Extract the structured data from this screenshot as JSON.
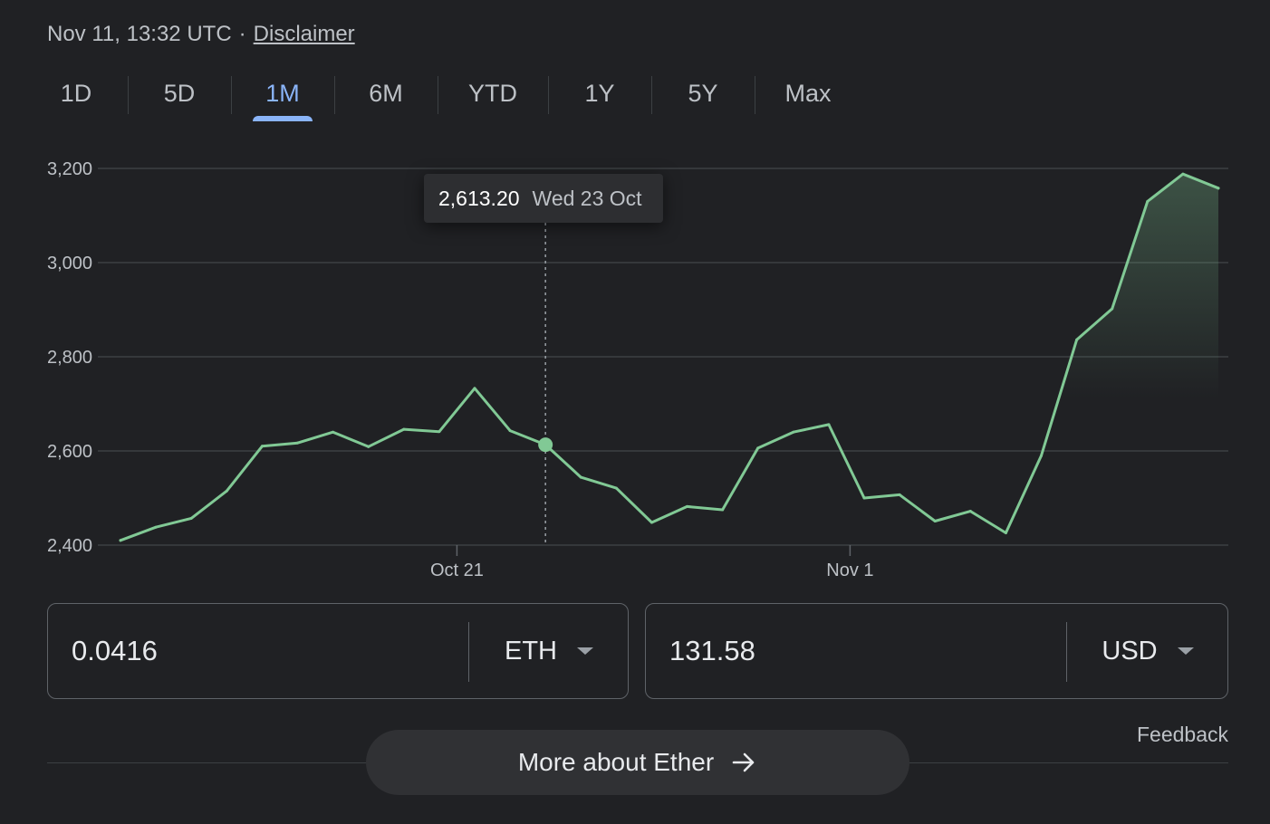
{
  "header": {
    "timestamp": "Nov 11, 13:32 UTC",
    "separator": "·",
    "disclaimer_label": "Disclaimer"
  },
  "range_tabs": [
    {
      "label": "1D",
      "active": false
    },
    {
      "label": "5D",
      "active": false
    },
    {
      "label": "1M",
      "active": true
    },
    {
      "label": "6M",
      "active": false
    },
    {
      "label": "YTD",
      "active": false
    },
    {
      "label": "1Y",
      "active": false
    },
    {
      "label": "5Y",
      "active": false
    },
    {
      "label": "Max",
      "active": false
    }
  ],
  "tooltip": {
    "value": "2,613.20",
    "date": "Wed 23 Oct"
  },
  "chart_data": {
    "type": "line",
    "x": [
      "Oct 12",
      "Oct 13",
      "Oct 14",
      "Oct 15",
      "Oct 16",
      "Oct 17",
      "Oct 18",
      "Oct 19",
      "Oct 20",
      "Oct 21",
      "Oct 22",
      "Oct 23",
      "Oct 24",
      "Oct 25",
      "Oct 26",
      "Oct 27",
      "Oct 28",
      "Oct 29",
      "Oct 30",
      "Oct 31",
      "Nov 1",
      "Nov 2",
      "Nov 3",
      "Nov 4",
      "Nov 5",
      "Nov 6",
      "Nov 7",
      "Nov 8",
      "Nov 9",
      "Nov 10",
      "Nov 11",
      "Nov 11 13:32"
    ],
    "values": [
      2410,
      2438,
      2457,
      2515,
      2610,
      2617,
      2640,
      2609,
      2646,
      2641,
      2733,
      2643,
      2613.2,
      2544,
      2521,
      2448,
      2482,
      2475,
      2606,
      2640,
      2656,
      2500,
      2507,
      2451,
      2472,
      2426,
      2590,
      2836,
      2902,
      3130,
      3188,
      3158
    ],
    "highlight_index": 12,
    "y_ticks": [
      "3,200",
      "3,000",
      "2,800",
      "2,600",
      "2,400"
    ],
    "y_tick_values": [
      3200,
      3000,
      2800,
      2600,
      2400
    ],
    "ylim": [
      2400,
      3200
    ],
    "x_ticks": [
      {
        "label": "Oct 21",
        "index": 9.5
      },
      {
        "label": "Nov 1",
        "index": 20.6
      }
    ],
    "grid": true,
    "line_color": "#81c995",
    "title": "",
    "xlabel": "",
    "ylabel": ""
  },
  "converter": {
    "from": {
      "amount": "0.0416",
      "currency": "ETH"
    },
    "to": {
      "amount": "131.58",
      "currency": "USD"
    }
  },
  "feedback_label": "Feedback",
  "more_button": {
    "label": "More about Ether",
    "icon": "arrow-right-icon"
  }
}
